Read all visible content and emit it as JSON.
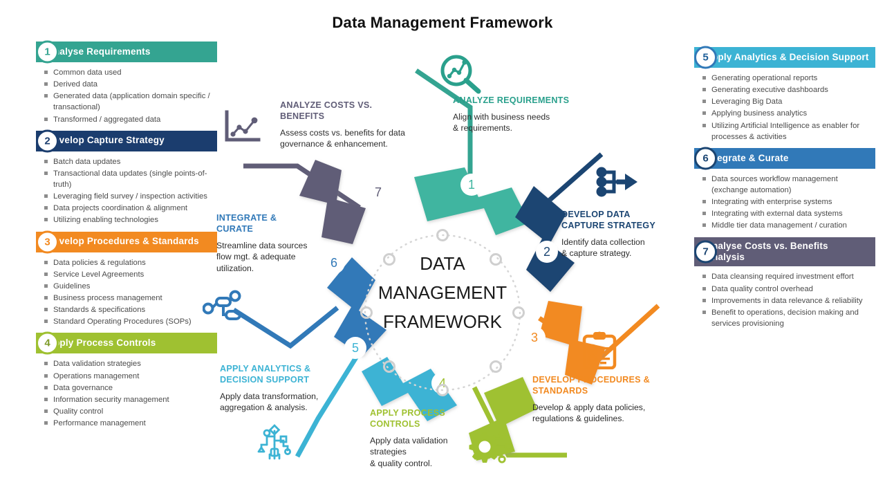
{
  "title": "Data Management Framework",
  "center": {
    "line1": "DATA",
    "line2": "MANAGEMENT",
    "line3": "FRAMEWORK"
  },
  "colors": {
    "teal": "#34a491",
    "navy": "#1b4572",
    "orange": "#f28a21",
    "green": "#9fc131",
    "cyan": "#3cb3d4",
    "blue": "#3179b8",
    "purple": "#605d77",
    "steel": "#1e5f99",
    "bullet_gray": "#8c8c8c",
    "text_gray": "#4b4b4b"
  },
  "left_panels": [
    {
      "number": "1",
      "header": "Analyse  Requirements",
      "color": "#34a491",
      "bullets": [
        "Common data used",
        "Derived data",
        "Generated  data (application domain specific / transactional)",
        "Transformed / aggregated data"
      ]
    },
    {
      "number": "2",
      "header": "Develop Capture Strategy",
      "color": "#1b3d6e",
      "bullets": [
        "Batch data updates",
        "Transactional data updates (single points-of-truth)",
        "Leveraging field survey / inspection activities",
        "Data projects coordination & alignment",
        "Utilizing enabling technologies"
      ]
    },
    {
      "number": "3",
      "header": "Develop Procedures & Standards",
      "color": "#f28a21",
      "bullets": [
        "Data policies & regulations",
        "Service Level  Agreements",
        "Guidelines",
        "Business process management",
        "Standards & specifications",
        "Standard Operating Procedures (SOPs)"
      ]
    },
    {
      "number": "4",
      "header": "Apply  Process Controls",
      "color": "#9fc131",
      "bullets": [
        "Data validation strategies",
        "Operations management",
        "Data governance",
        "Information security management",
        "Quality control",
        "Performance management"
      ]
    }
  ],
  "right_panels": [
    {
      "number": "5",
      "header": "Apply  Analytics  & Decision Support",
      "color": "#3cb3d4",
      "bullets": [
        "Generating operational reports",
        "Generating executive dashboards",
        "Leveraging  Big Data",
        "Applying business analytics",
        "Utilizing Artificial Intelligence as enabler for processes & activities"
      ]
    },
    {
      "number": "6",
      "header": "Integrate & Curate",
      "color": "#3179b8",
      "bullets": [
        "Data sources workflow management (exchange automation)",
        "Integrating with enterprise systems",
        "Integrating with external data systems",
        "Middle tier data management  / curation"
      ]
    },
    {
      "number": "7",
      "header": "Analyse  Costs vs. Benefits Analysis",
      "color": "#605d77",
      "bullets": [
        "Data cleansing required investment effort",
        "Data quality control overhead",
        "Improvements  in data relevance & reliability",
        "Benefit to operations, decision making and services provisioning"
      ]
    }
  ],
  "spokes": [
    {
      "key": "analyze_requirements",
      "number": "1",
      "title": "ANALYZE  REQUIREMENTS",
      "desc": "Align with business needs\n& requirements.",
      "color": "#34a491",
      "icon": "magnifier-chart-icon"
    },
    {
      "key": "develop_capture_strategy",
      "number": "2",
      "title": "DEVELOP DATA CAPTURE STRATEGY",
      "desc": "Identify data collection\n& capture strategy.",
      "color": "#1b4572",
      "icon": "merge-arrow-icon"
    },
    {
      "key": "develop_procedures",
      "number": "3",
      "title": "DEVELOP PROCEDURES & STANDARDS",
      "desc": "Develop & apply data policies,\nregulations & guidelines.",
      "color": "#f28a21",
      "icon": "clipboard-checklist-icon"
    },
    {
      "key": "apply_process_controls",
      "number": "4",
      "title": "APPLY PROCESS CONTROLS",
      "desc": "Apply data validation strategies\n& quality control.",
      "color": "#9fc131",
      "icon": "gear-circuit-icon"
    },
    {
      "key": "apply_analytics",
      "number": "5",
      "title": "APPLY ANALYTICS & DECISION SUPPORT",
      "desc": "Apply data transformation,\naggregation & analysis.",
      "color": "#3cb3d4",
      "icon": "circuit-tree-icon"
    },
    {
      "key": "integrate_curate",
      "number": "6",
      "title": "INTEGRATE & CURATE",
      "desc": "Streamline data sources\nflow mgt. & adequate\nutilization.",
      "color": "#3179b8",
      "icon": "node-network-icon"
    },
    {
      "key": "analyze_costs",
      "number": "7",
      "title": "ANALYZE  COSTS VS. BENEFITS",
      "desc": "Assess costs vs. benefits for data\ngovernance & enhancement.",
      "color": "#605d77",
      "icon": "line-chart-icon"
    }
  ],
  "spoke_titles": {
    "analyze_requirements_l1": "ANALYZE  REQUIREMENTS",
    "capture_l1": "DEVELOP DATA",
    "capture_l2": "CAPTURE STRATEGY",
    "procedures_l1": "DEVELOP PROCEDURES &",
    "procedures_l2": "STANDARDS",
    "process_l1": "APPLY PROCESS",
    "process_l2": "CONTROLS",
    "analytics_l1": "APPLY ANALYTICS &",
    "analytics_l2": "DECISION SUPPORT",
    "integrate_l1": "INTEGRATE &",
    "integrate_l2": "CURATE",
    "costs_l1": "ANALYZE  COSTS VS.",
    "costs_l2": "BENEFITS"
  },
  "spoke_descs": {
    "analyze_requirements_l1": "Align with business needs",
    "analyze_requirements_l2": "& requirements.",
    "capture_l1": "Identify data collection",
    "capture_l2": "& capture strategy.",
    "procedures_l1": "Develop & apply data policies,",
    "procedures_l2": "regulations & guidelines.",
    "process_l1": "Apply data validation",
    "process_l2": "strategies",
    "process_l3": "& quality control.",
    "analytics_l1": "Apply data transformation,",
    "analytics_l2": "aggregation & analysis.",
    "integrate_l1": "Streamline data sources",
    "integrate_l2": "flow mgt. & adequate",
    "integrate_l3": "utilization.",
    "costs_l1": "Assess costs vs. benefits for data",
    "costs_l2": "governance & enhancement."
  },
  "ring_numbers": [
    "1",
    "2",
    "3",
    "4",
    "5",
    "6",
    "7"
  ]
}
